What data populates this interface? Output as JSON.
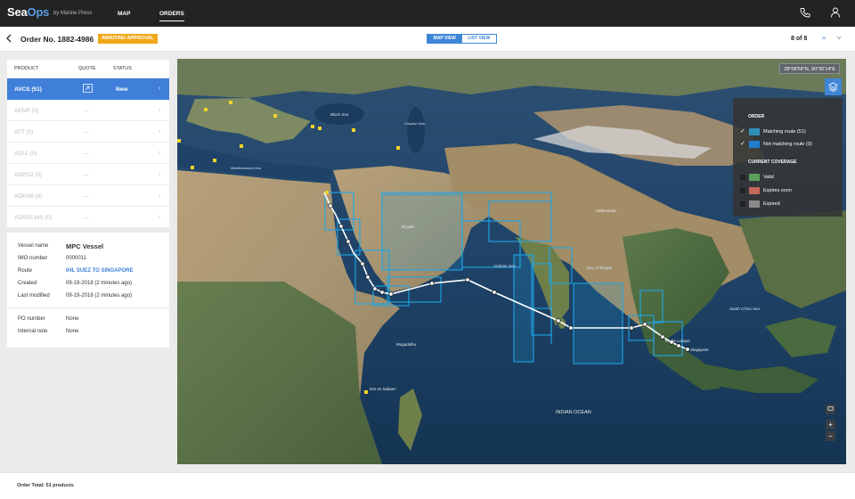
{
  "app": {
    "logo_prefix": "Sea",
    "logo_suffix": "Ops",
    "byline": "by Marine Press"
  },
  "nav": {
    "map": "MAP",
    "orders": "ORDERS"
  },
  "order": {
    "title": "Order No. 1882-4986",
    "status_badge": "AWAITING APPROVAL",
    "view_toggle": {
      "map_view": "MAP VIEW",
      "list_view": "LIST VIEW"
    },
    "pager": "8 of 8"
  },
  "products": {
    "headers": {
      "product": "PRODUCT",
      "quote": "QUOTE",
      "status": "STATUS"
    },
    "rows": [
      {
        "name": "AVCS (51)",
        "quote": "",
        "status": "New"
      },
      {
        "name": "AENP (0)",
        "quote": "—",
        "status": ""
      },
      {
        "name": "ATT (0)",
        "quote": "—",
        "status": ""
      },
      {
        "name": "ADLL (0)",
        "quote": "—",
        "status": ""
      },
      {
        "name": "ADRS2 (0)",
        "quote": "—",
        "status": ""
      },
      {
        "name": "ADRS6 (0)",
        "quote": "—",
        "status": ""
      },
      {
        "name": "ADRS1345 (0)",
        "quote": "—",
        "status": ""
      }
    ]
  },
  "details": {
    "vessel_label": "Vessel name",
    "vessel_value": "MPC Vessel",
    "imo_label": "IMO number",
    "imo_value": "0000011",
    "route_label": "Route",
    "route_value": "04L SUEZ TO SINGAPORE",
    "created_label": "Created",
    "created_value": "09-19-2018 (2 minutes ago)",
    "modified_label": "Last modified",
    "modified_value": "09-19-2018 (2 minutes ago)",
    "po_label": "PO number",
    "po_value": "None",
    "note_label": "Internal note",
    "note_value": "None"
  },
  "map": {
    "coordinates": "28°08'58\"N, 90°30'14\"E",
    "labels": {
      "indian_ocean": "INDIAN OCEAN",
      "arabian_sea": "Arabian Sea",
      "black_sea": "Black Sea",
      "caspian_sea": "Caspian Sea",
      "mediterranean": "Mediterranean Sea",
      "riyadh": "Riyadh",
      "kathmandu": "Kathmandu",
      "mogadishu": "Mogadishu",
      "dar_es_salaam": "Dar es Salaam",
      "kuala_lumpur": "Kuala Lumpur",
      "singapore": "Singapore",
      "south_china_sea": "South China Sea",
      "bay_of_bengal": "Bay of Bengal"
    },
    "legend": {
      "order_title": "ORDER",
      "matching": "Matching route (51)",
      "not_matching": "Not matching route (0)",
      "coverage_title": "CURRENT COVERAGE",
      "valid": "Valid",
      "expires_soon": "Expires soon",
      "expired": "Expired"
    },
    "colors": {
      "matching": "#2f8fb8",
      "not_matching": "#1f7fcf",
      "valid": "#5aa05a",
      "expires_soon": "#c4685a",
      "expired": "#8a8a8a",
      "accent": "#3f86d6",
      "badge": "#f0a819"
    }
  },
  "footer": {
    "total": "Order Total: 51 products"
  }
}
